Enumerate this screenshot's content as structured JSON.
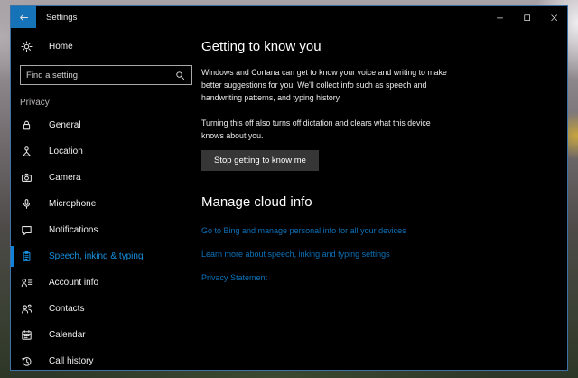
{
  "window": {
    "title": "Settings",
    "controls": {
      "minimize": "minimize",
      "maximize": "maximize",
      "close": "close"
    }
  },
  "sidebar": {
    "home": {
      "label": "Home",
      "icon": "gear-icon"
    },
    "search": {
      "placeholder": "Find a setting",
      "icon": "search-icon"
    },
    "section_label": "Privacy",
    "items": [
      {
        "label": "General",
        "icon": "lock-icon",
        "selected": false
      },
      {
        "label": "Location",
        "icon": "location-icon",
        "selected": false
      },
      {
        "label": "Camera",
        "icon": "camera-icon",
        "selected": false
      },
      {
        "label": "Microphone",
        "icon": "microphone-icon",
        "selected": false
      },
      {
        "label": "Notifications",
        "icon": "notifications-icon",
        "selected": false
      },
      {
        "label": "Speech, inking & typing",
        "icon": "clipboard-icon",
        "selected": true
      },
      {
        "label": "Account info",
        "icon": "account-info-icon",
        "selected": false
      },
      {
        "label": "Contacts",
        "icon": "contacts-icon",
        "selected": false
      },
      {
        "label": "Calendar",
        "icon": "calendar-icon",
        "selected": false
      },
      {
        "label": "Call history",
        "icon": "call-history-icon",
        "selected": false
      }
    ]
  },
  "main": {
    "getting_to_know_you": {
      "heading": "Getting to know you",
      "paragraph1": "Windows and Cortana can get to know your voice and writing to make better suggestions for you. We'll collect info such as speech and handwriting patterns, and typing history.",
      "paragraph2": "Turning this off also turns off dictation and clears what this device knows about you.",
      "button_label": "Stop getting to know me"
    },
    "manage_cloud_info": {
      "heading": "Manage cloud info",
      "links": [
        "Go to Bing and manage personal info for all your devices",
        "Learn more about speech, inking and typing settings",
        "Privacy Statement"
      ]
    }
  },
  "colors": {
    "window_bg": "#000000",
    "back_button_bg": "#1673b8",
    "selected_accent_bar": "#1080d8",
    "selected_text": "#1692e2",
    "link_blue": "#0d72ba",
    "button_bg": "#363636",
    "window_border": "#3e72a6"
  }
}
